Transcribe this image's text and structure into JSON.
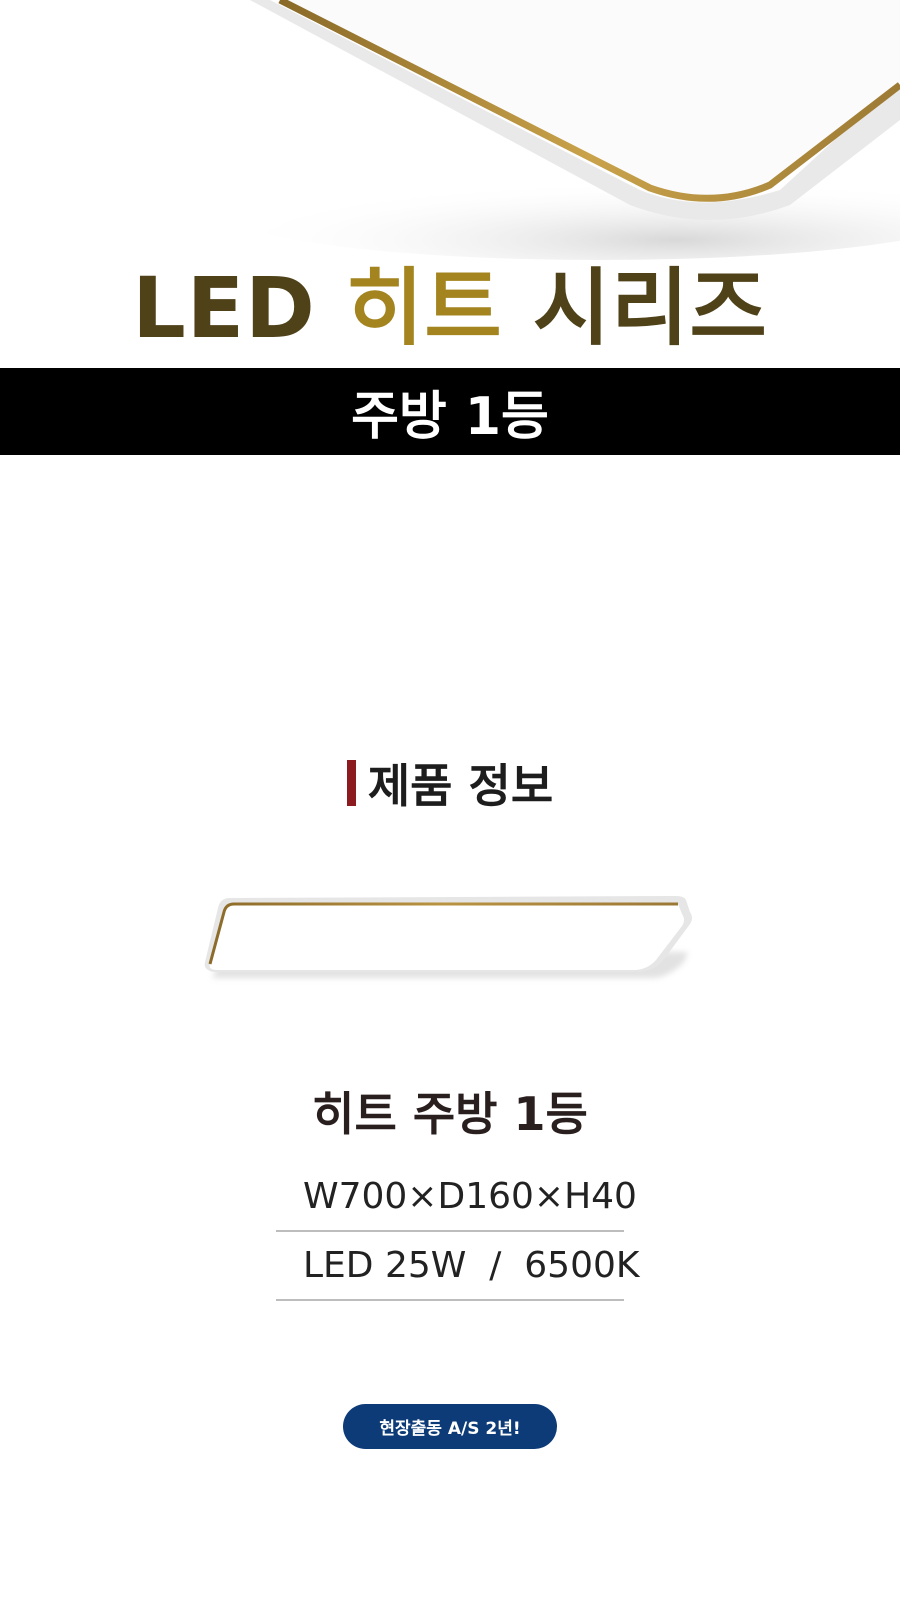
{
  "hero": {
    "title_led": "LED",
    "title_heat": "히트",
    "title_series": "시리즈"
  },
  "category_band": {
    "label": "주방 1등"
  },
  "section": {
    "label": "제품 정보"
  },
  "product": {
    "name": "히트 주방 1등",
    "specs": [
      {
        "text": "W700×D160×H40"
      },
      {
        "text": "LED 25W  /  6500K"
      }
    ]
  },
  "badge": {
    "label": "현장출동 A/S 2년!"
  },
  "colors": {
    "title_dark": "#4f4219",
    "title_gold": "#a3841f",
    "band": "#000000",
    "section_bar": "#8b1b1f",
    "spec_bullet": "#c0392b",
    "badge_bg": "#0c3b78"
  }
}
